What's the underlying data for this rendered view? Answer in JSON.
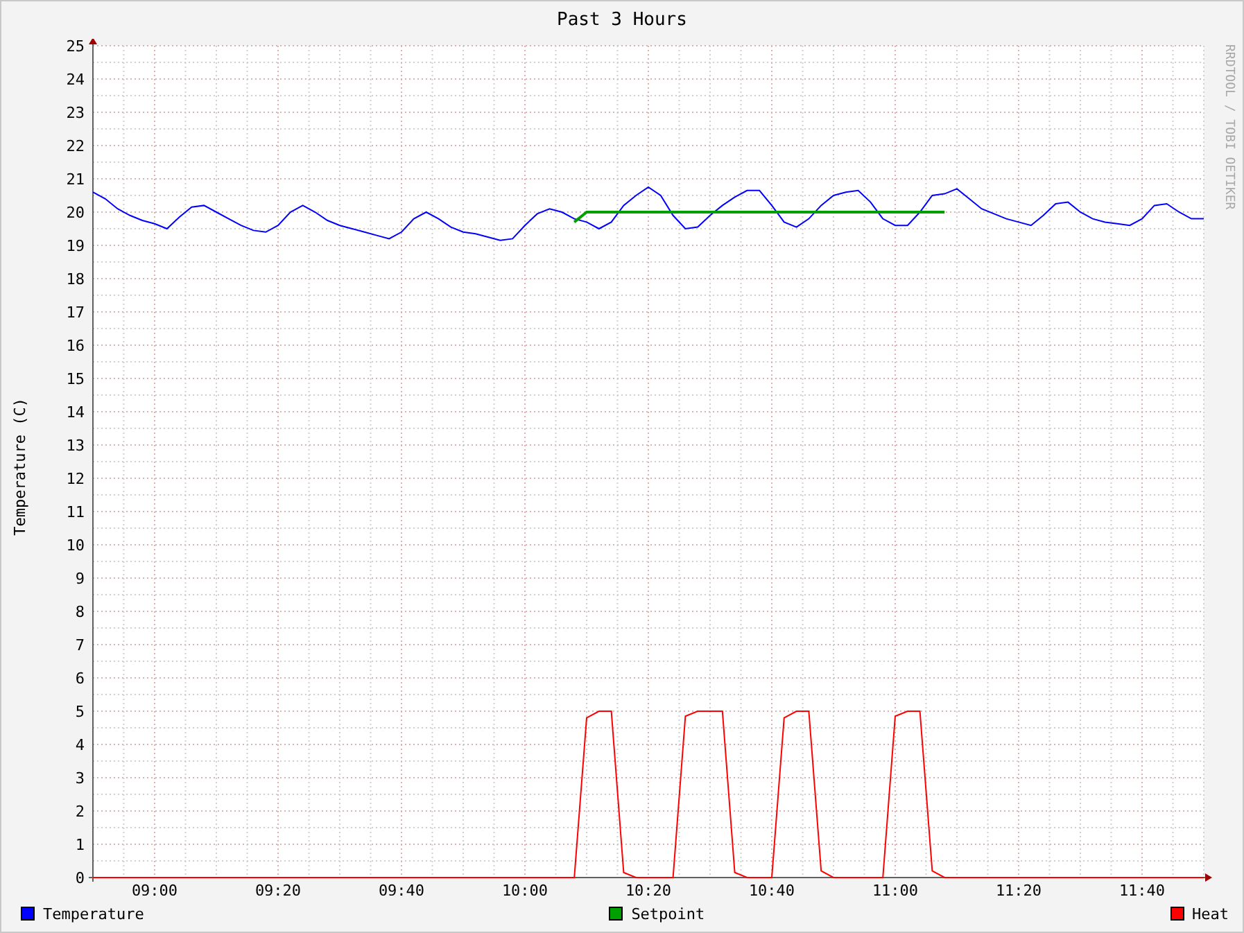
{
  "graph": {
    "credit": "RRDTOOL / TOBI OETIKER",
    "chart_data": {
      "type": "line",
      "title": "Past 3 Hours",
      "ylabel": "Temperature (C)",
      "grid": true,
      "ylim": [
        0,
        25
      ],
      "yticks": [
        0,
        1,
        2,
        3,
        4,
        5,
        6,
        7,
        8,
        9,
        10,
        11,
        12,
        13,
        14,
        15,
        16,
        17,
        18,
        19,
        20,
        21,
        22,
        23,
        24,
        25
      ],
      "categories": [
        null,
        null,
        null,
        null,
        null,
        "09:00",
        null,
        null,
        null,
        null,
        null,
        null,
        null,
        null,
        null,
        "09:20",
        null,
        null,
        null,
        null,
        null,
        null,
        null,
        null,
        null,
        "09:40",
        null,
        null,
        null,
        null,
        null,
        null,
        null,
        null,
        null,
        "10:00",
        null,
        null,
        null,
        null,
        null,
        null,
        null,
        null,
        null,
        "10:20",
        null,
        null,
        null,
        null,
        null,
        null,
        null,
        null,
        null,
        "10:40",
        null,
        null,
        null,
        null,
        null,
        null,
        null,
        null,
        null,
        "11:00",
        null,
        null,
        null,
        null,
        null,
        null,
        null,
        null,
        null,
        "11:20",
        null,
        null,
        null,
        null,
        null,
        null,
        null,
        null,
        null,
        "11:40",
        null,
        null,
        null,
        null,
        null
      ],
      "series": [
        {
          "name": "Temperature",
          "color": "#0000ff",
          "values": [
            20.6,
            20.4,
            20.1,
            19.9,
            19.75,
            19.65,
            19.5,
            19.85,
            20.15,
            20.2,
            20.0,
            19.8,
            19.6,
            19.45,
            19.4,
            19.6,
            20.0,
            20.2,
            20.0,
            19.75,
            19.6,
            19.5,
            19.4,
            19.3,
            19.2,
            19.4,
            19.8,
            20.0,
            19.8,
            19.55,
            19.4,
            19.35,
            19.25,
            19.15,
            19.2,
            19.6,
            19.95,
            20.1,
            20.0,
            19.8,
            19.7,
            19.5,
            19.7,
            20.2,
            20.5,
            20.75,
            20.5,
            19.9,
            19.5,
            19.55,
            19.9,
            20.2,
            20.45,
            20.65,
            20.65,
            20.2,
            19.7,
            19.55,
            19.8,
            20.2,
            20.5,
            20.6,
            20.65,
            20.3,
            19.8,
            19.6,
            19.6,
            20.0,
            20.5,
            20.55,
            20.7,
            20.4,
            20.1,
            19.95,
            19.8,
            19.7,
            19.6,
            19.9,
            20.25,
            20.3,
            20.0,
            19.8,
            19.7,
            19.65,
            19.6,
            19.8,
            20.2,
            20.25,
            20.0,
            19.8,
            19.8
          ]
        },
        {
          "name": "Setpoint",
          "color": "#00a000",
          "values": [
            null,
            null,
            null,
            null,
            null,
            null,
            null,
            null,
            null,
            null,
            null,
            null,
            null,
            null,
            null,
            null,
            null,
            null,
            null,
            null,
            null,
            null,
            null,
            null,
            null,
            null,
            null,
            null,
            null,
            null,
            null,
            null,
            null,
            null,
            null,
            null,
            null,
            null,
            null,
            19.7,
            20,
            20,
            20,
            20,
            20,
            20,
            20,
            20,
            20,
            20,
            20,
            20,
            20,
            20,
            20,
            20,
            20,
            20,
            20,
            20,
            20,
            20,
            20,
            20,
            20,
            20,
            20,
            20,
            20,
            20,
            null,
            null,
            null,
            null,
            null,
            null,
            null,
            null,
            null,
            null,
            null,
            null,
            null,
            null,
            null,
            null,
            null,
            null,
            null,
            null,
            null
          ]
        },
        {
          "name": "Heat",
          "color": "#ff0000",
          "values": [
            0,
            0,
            0,
            0,
            0,
            0,
            0,
            0,
            0,
            0,
            0,
            0,
            0,
            0,
            0,
            0,
            0,
            0,
            0,
            0,
            0,
            0,
            0,
            0,
            0,
            0,
            0,
            0,
            0,
            0,
            0,
            0,
            0,
            0,
            0,
            0,
            0,
            0,
            0,
            0,
            4.8,
            5,
            5,
            0.15,
            0,
            0,
            0,
            0,
            4.85,
            5,
            5,
            5,
            0.15,
            0,
            0,
            0,
            4.8,
            5,
            5,
            0.2,
            0,
            0,
            0,
            0,
            0,
            4.85,
            5,
            5,
            0.2,
            0,
            0,
            0,
            0,
            0,
            0,
            0,
            0,
            0,
            0,
            0,
            0,
            0,
            0,
            0,
            0,
            0,
            0,
            0,
            0,
            0,
            0
          ]
        }
      ]
    }
  }
}
